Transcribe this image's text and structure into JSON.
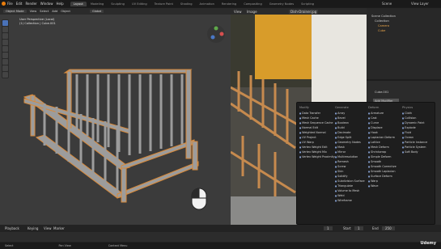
{
  "topbar": {
    "menu": [
      "File",
      "Edit",
      "Render",
      "Window",
      "Help"
    ],
    "tabs": [
      "Layout",
      "Modeling",
      "Sculpting",
      "UV Editing",
      "Texture Paint",
      "Shading",
      "Animation",
      "Rendering",
      "Compositing",
      "Geometry Nodes",
      "Scripting"
    ],
    "active_tab": "Layout",
    "scene_label": "Scene",
    "view_layer_label": "View Layer"
  },
  "viewport": {
    "mode": "Object Mode",
    "view": "View",
    "select": "Select",
    "add": "Add",
    "object": "Object",
    "transform": "Global",
    "info_line1": "User Perspective (Local)",
    "info_line2": "(1) Collection | Cube.001"
  },
  "image_editor": {
    "filename": "Dish-Drainer.jpg",
    "view": "View",
    "image": "Image"
  },
  "outliner": {
    "title": "Scene Collection",
    "items": [
      "Collection",
      "Camera",
      "Cube"
    ]
  },
  "properties": {
    "object_name": "Cube.001",
    "add_modifier_label": "Add Modifier"
  },
  "add_menu": {
    "columns": [
      {
        "header": "Modify",
        "items": [
          "Data Transfer",
          "Mesh Cache",
          "Mesh Sequence Cache",
          "Normal Edit",
          "Weighted Normal",
          "UV Project",
          "UV Warp",
          "Vertex Weight Edit",
          "Vertex Weight Mix",
          "Vertex Weight Proximity"
        ]
      },
      {
        "header": "Generate",
        "items": [
          "Array",
          "Bevel",
          "Boolean",
          "Build",
          "Decimate",
          "Edge Split",
          "Geometry Nodes",
          "Mask",
          "Mirror",
          "Multiresolution",
          "Remesh",
          "Screw",
          "Skin",
          "Solidify",
          "Subdivision Surface",
          "Triangulate",
          "Volume to Mesh",
          "Weld",
          "Wireframe"
        ]
      },
      {
        "header": "Deform",
        "items": [
          "Armature",
          "Cast",
          "Curve",
          "Displace",
          "Hook",
          "Laplacian Deform",
          "Lattice",
          "Mesh Deform",
          "Shrinkwrap",
          "Simple Deform",
          "Smooth",
          "Smooth Corrective",
          "Smooth Laplacian",
          "Surface Deform",
          "Warp",
          "Wave"
        ]
      },
      {
        "header": "Physics",
        "items": [
          "Cloth",
          "Collision",
          "Dynamic Paint",
          "Explode",
          "Fluid",
          "Ocean",
          "Particle Instance",
          "Particle System",
          "Soft Body"
        ]
      }
    ]
  },
  "timeline": {
    "playback": "Playback",
    "keying": "Keying",
    "view": "View",
    "marker": "Marker",
    "frame_current": "1",
    "start_label": "Start",
    "start": "1",
    "end_label": "End",
    "end": "250"
  },
  "statusbar": {
    "select": "Select",
    "pan_view": "Pan View",
    "context_menu": "Context Menu"
  },
  "watermark": "Udemy",
  "colors": {
    "accent": "#4a72b8",
    "wood_orange": "#d98a3a",
    "model_grey": "#9a9a9a"
  }
}
